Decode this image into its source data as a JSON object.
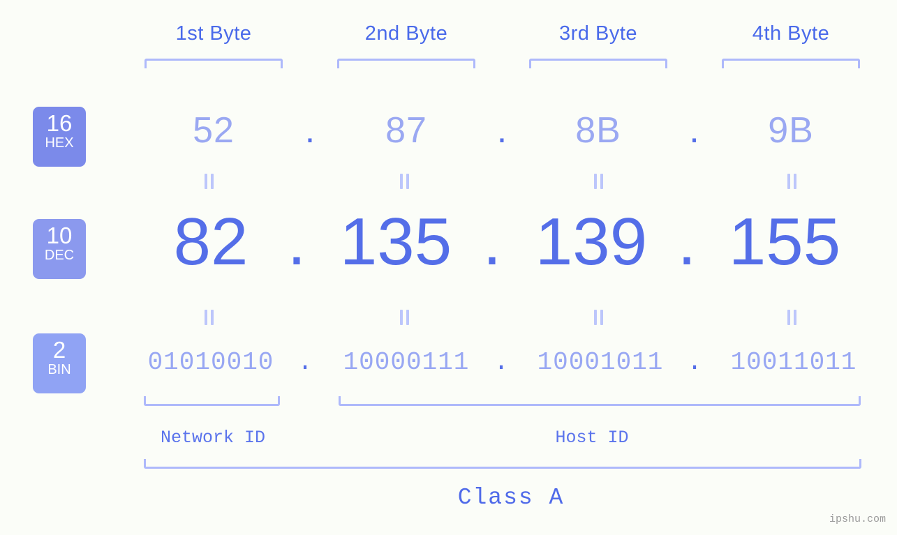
{
  "page": {
    "background_color": "#fbfdf8",
    "accent_color": "#546ee8",
    "light_accent_color": "#aeb9fb",
    "watermark": "ipshu.com"
  },
  "byte_headers": [
    {
      "label": "1st Byte"
    },
    {
      "label": "2nd Byte"
    },
    {
      "label": "3rd Byte"
    },
    {
      "label": "4th Byte"
    }
  ],
  "rows": {
    "hex": {
      "badge_number": "16",
      "badge_base": "HEX",
      "badge_color": "#7b8aea",
      "values": [
        "52",
        "87",
        "8B",
        "9B"
      ],
      "separator": "."
    },
    "dec": {
      "badge_number": "10",
      "badge_base": "DEC",
      "badge_color": "#8b99ee",
      "values": [
        "82",
        "135",
        "139",
        "155"
      ],
      "separator": "."
    },
    "bin": {
      "badge_number": "2",
      "badge_base": "BIN",
      "badge_color": "#90a3f4",
      "values": [
        "01010010",
        "10000111",
        "10001011",
        "10011011"
      ],
      "separator": "."
    }
  },
  "segments": {
    "network_id": "Network ID",
    "host_id": "Host ID",
    "class": "Class A"
  },
  "ip_address": "82.135.139.155"
}
